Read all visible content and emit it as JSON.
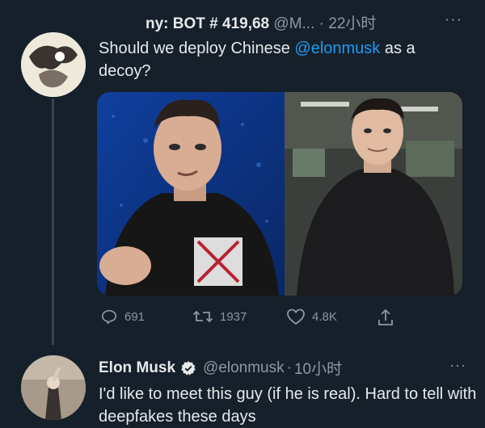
{
  "tweet1": {
    "name": "ny: BOT # 419,68",
    "handle": "@M...",
    "time_sep": "·",
    "time": "22小时",
    "more": "···",
    "text_before": "Should we deploy Chinese ",
    "mention": "@elonmusk",
    "text_after": " as a decoy?",
    "actions": {
      "replies": "691",
      "retweets": "1937",
      "likes": "4.8K"
    },
    "icons": [
      "reply-icon",
      "retweet-icon",
      "like-icon",
      "share-icon"
    ]
  },
  "tweet2": {
    "name": "Elon Musk",
    "handle": "@elonmusk",
    "time_sep": "·",
    "time": "10小时",
    "more": "···",
    "text": "I'd like to meet this guy (if he is real). Hard to tell with deepfakes these days"
  },
  "colors": {
    "background": "#15202b",
    "text": "#e7e9ea",
    "muted": "#8b98a5",
    "accent": "#1d9bf0"
  }
}
